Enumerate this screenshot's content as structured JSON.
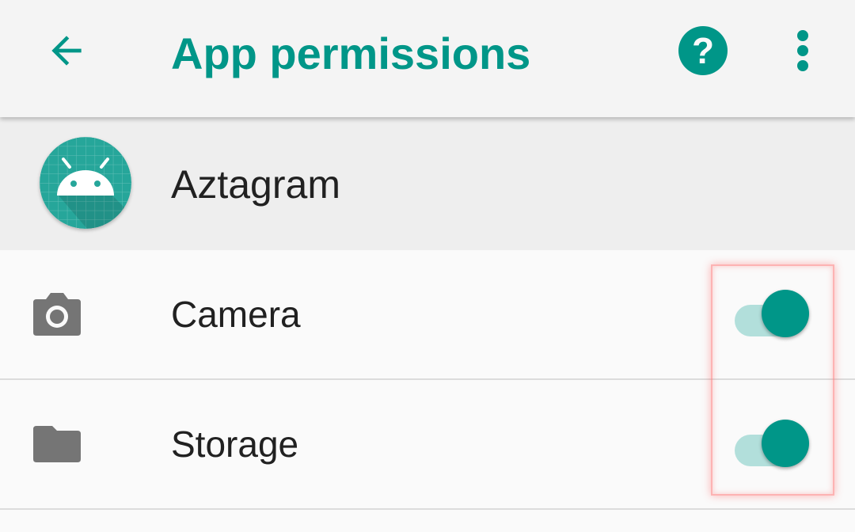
{
  "appbar": {
    "title": "App permissions",
    "back_icon": "arrow-back-icon",
    "help_icon": "help-icon",
    "help_glyph": "?",
    "more_icon": "more-vert-icon",
    "accent_color": "#009688"
  },
  "app": {
    "name": "Aztagram",
    "icon": "android-icon"
  },
  "permissions": [
    {
      "label": "Camera",
      "icon": "camera-icon",
      "enabled": true
    },
    {
      "label": "Storage",
      "icon": "folder-icon",
      "enabled": true
    }
  ]
}
